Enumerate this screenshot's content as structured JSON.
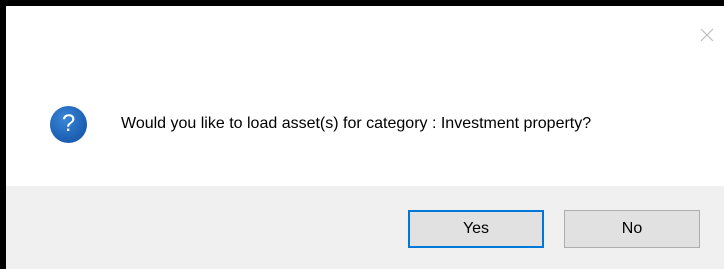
{
  "dialog": {
    "message": "Would you like to load asset(s) for category : Investment property?",
    "icon": "question-icon",
    "close_icon": "close-icon",
    "buttons": {
      "yes_label": "Yes",
      "no_label": "No"
    },
    "colors": {
      "icon_blue": "#1f63b6",
      "focus_border": "#0078d7",
      "footer_bg": "#f0f0f0",
      "button_bg": "#e1e1e1"
    }
  }
}
